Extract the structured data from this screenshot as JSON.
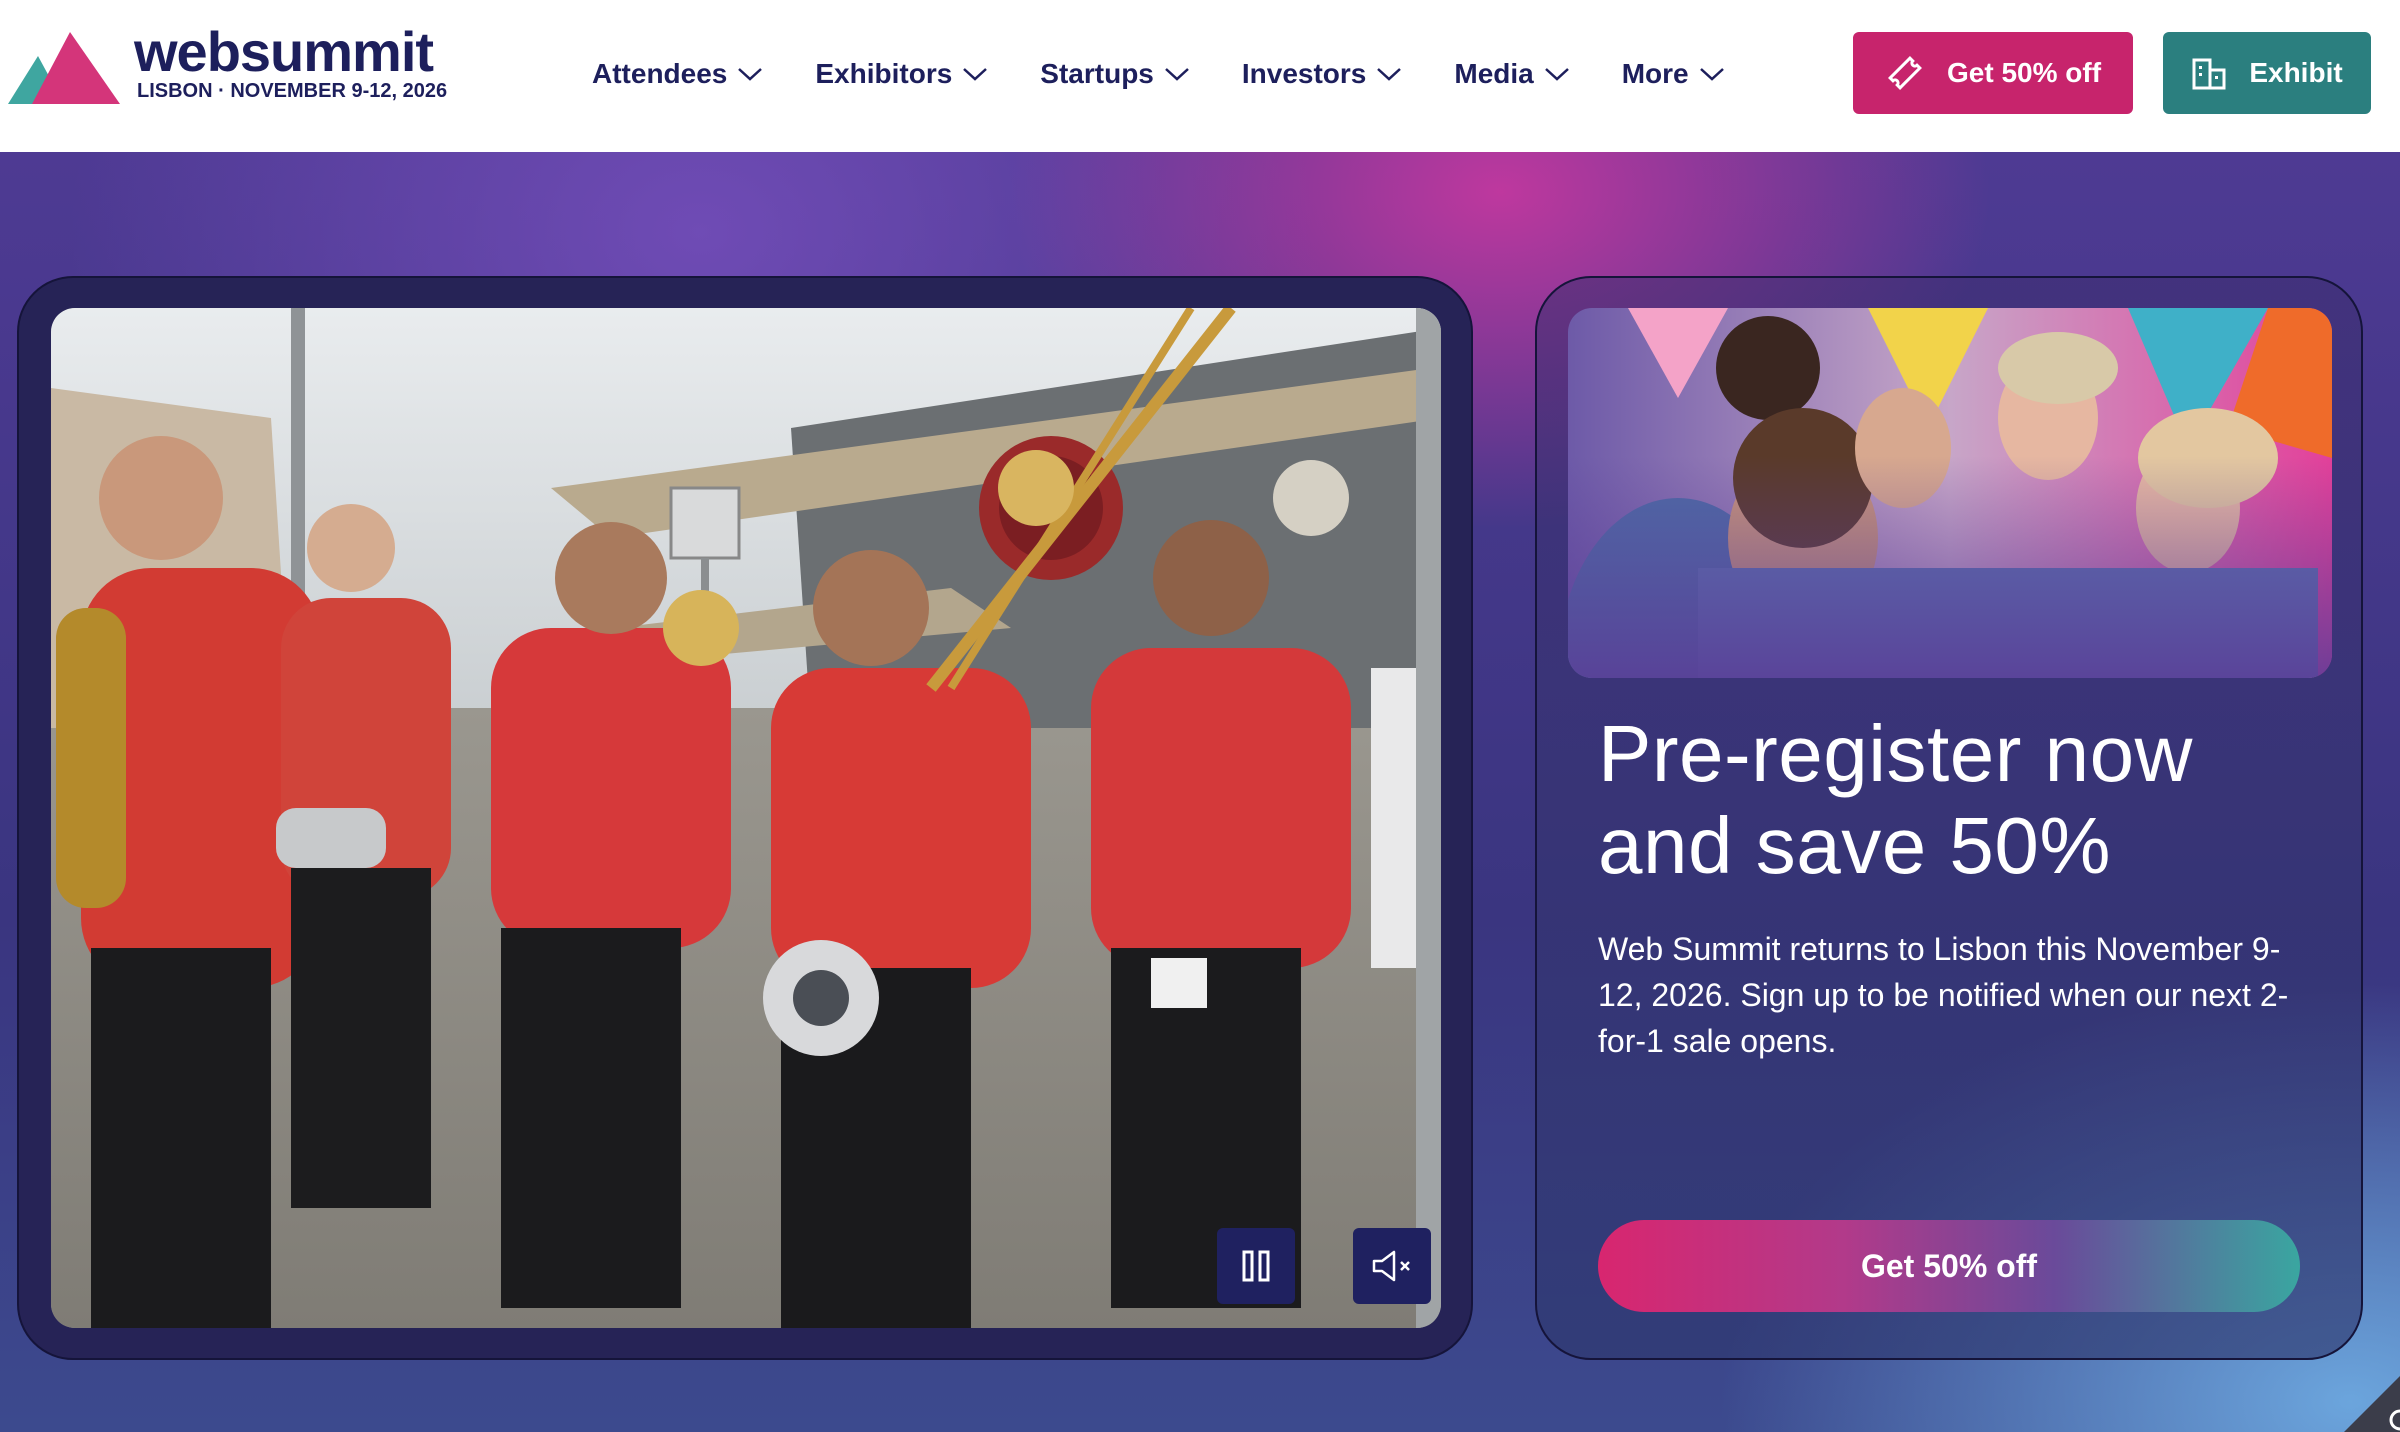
{
  "brand": {
    "name": "websummit",
    "tagline": "LISBON · NOVEMBER 9-12, 2026",
    "colors": {
      "navy": "#1d1f5c",
      "pink": "#c7246c",
      "teal": "#2b7f7f"
    }
  },
  "nav": {
    "items": [
      {
        "label": "Attendees",
        "icon": "chevron-down-icon"
      },
      {
        "label": "Exhibitors",
        "icon": "chevron-down-icon"
      },
      {
        "label": "Startups",
        "icon": "chevron-down-icon"
      },
      {
        "label": "Investors",
        "icon": "chevron-down-icon"
      },
      {
        "label": "Media",
        "icon": "chevron-down-icon"
      },
      {
        "label": "More",
        "icon": "chevron-down-icon"
      }
    ]
  },
  "header_actions": {
    "discount_label": "Get 50% off",
    "discount_icon": "ticket-icon",
    "exhibit_label": "Exhibit",
    "exhibit_icon": "building-icon"
  },
  "video": {
    "pause_icon": "pause-icon",
    "mute_icon": "muted-speaker-icon"
  },
  "promo": {
    "title": "Pre-register now and save 50%",
    "text": "Web Summit returns to Lisbon this November 9-12, 2026. Sign up to be notified when our next 2-for-1 sale opens.",
    "button_label": "Get 50% off"
  }
}
